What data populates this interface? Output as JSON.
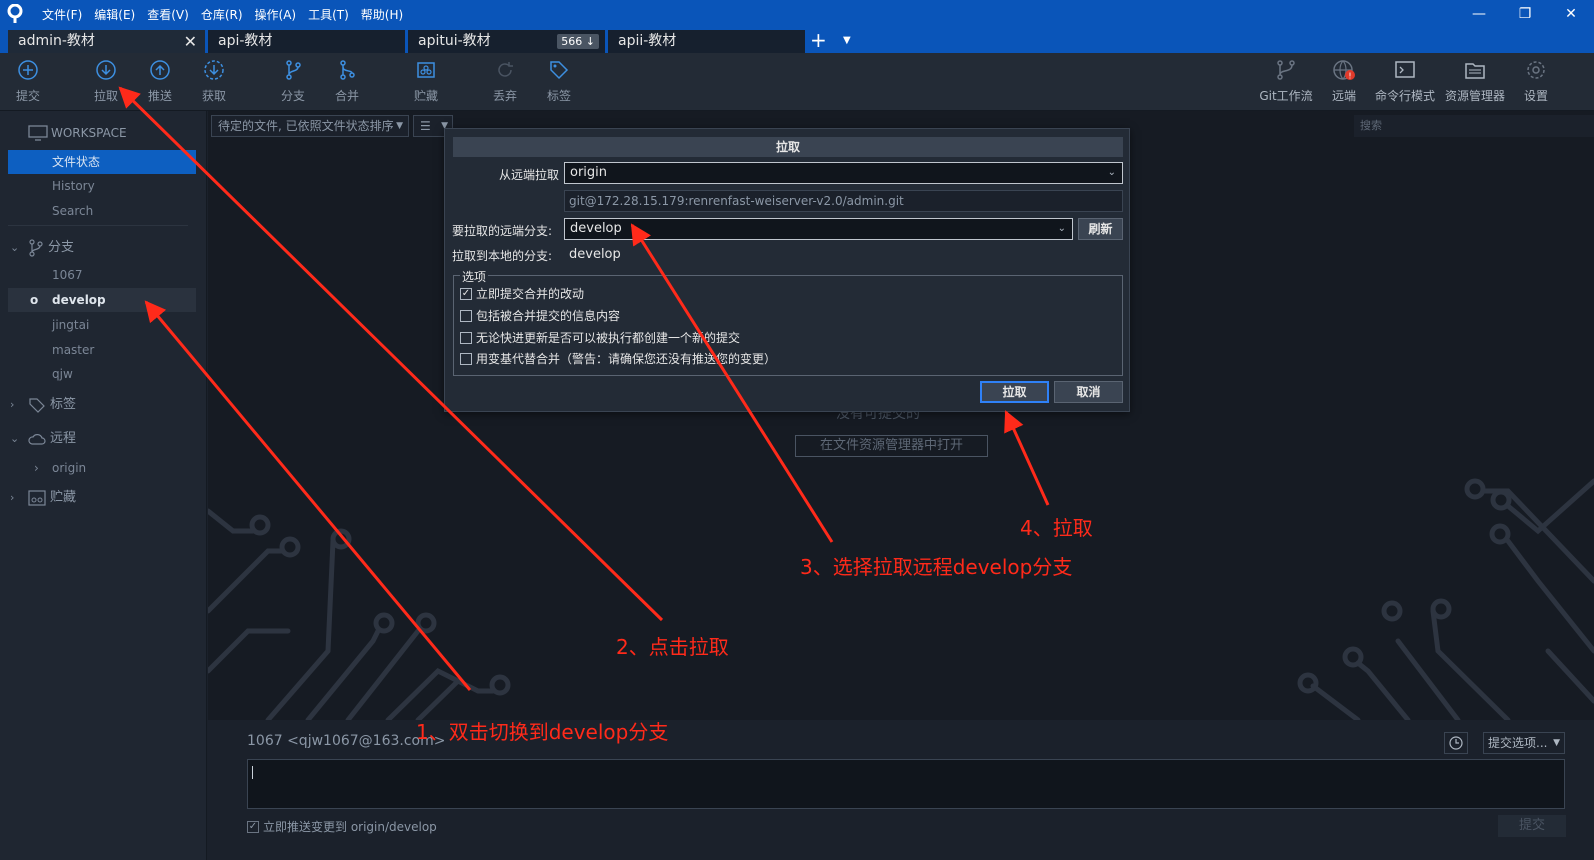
{
  "titlebar": {
    "menus": [
      "文件(F)",
      "编辑(E)",
      "查看(V)",
      "仓库(R)",
      "操作(A)",
      "工具(T)",
      "帮助(H)"
    ],
    "window_controls": [
      "minimize-icon",
      "restore-icon",
      "close-icon"
    ]
  },
  "tabs": [
    {
      "label": "admin-教材",
      "active": true
    },
    {
      "label": "api-教材"
    },
    {
      "label": "apitui-教材",
      "badge": "566 ↓"
    },
    {
      "label": "apii-教材"
    }
  ],
  "toolbar": {
    "left": [
      {
        "label": "提交",
        "icon": "plus-circle-icon"
      },
      {
        "label": "拉取",
        "icon": "arrow-down-circle-icon"
      },
      {
        "label": "推送",
        "icon": "arrow-up-circle-icon"
      },
      {
        "label": "获取",
        "icon": "fetch-circle-icon"
      },
      {
        "label": "分支",
        "icon": "branch-icon"
      },
      {
        "label": "合并",
        "icon": "merge-icon"
      },
      {
        "label": "贮藏",
        "icon": "stash-icon"
      },
      {
        "label": "丢弃",
        "icon": "discard-icon"
      },
      {
        "label": "标签",
        "icon": "tag-icon"
      }
    ],
    "right": [
      {
        "label": "Git工作流",
        "icon": "git-flow-icon"
      },
      {
        "label": "远端",
        "icon": "globe-icon"
      },
      {
        "label": "命令行模式",
        "icon": "terminal-icon"
      },
      {
        "label": "资源管理器",
        "icon": "folder-icon"
      },
      {
        "label": "设置",
        "icon": "gear-icon"
      }
    ]
  },
  "sidebar": {
    "workspace_label": "WORKSPACE",
    "workspace_items": [
      "文件状态",
      "History",
      "Search"
    ],
    "branches_label": "分支",
    "branches": [
      "1067",
      "develop",
      "jingtai",
      "master",
      "qjw"
    ],
    "current_branch_marker": "o",
    "tags_label": "标签",
    "remotes_label": "远程",
    "remotes": [
      "origin"
    ],
    "stashes_label": "贮藏"
  },
  "main": {
    "filter_dropdown": "待定的文件, 已依照文件状态排序",
    "view_dropdown": "☰",
    "search_placeholder": "搜索",
    "empty_text": "没有可提交的",
    "open_in_explorer": "在文件资源管理器中打开"
  },
  "dialog": {
    "title": "拉取",
    "remote_label": "从远端拉取",
    "remote_value": "origin",
    "remote_url": "git@172.28.15.179:renrenfast-weiserver-v2.0/admin.git",
    "remote_branch_label": "要拉取的远端分支:",
    "remote_branch_value": "develop",
    "refresh_button": "刷新",
    "local_branch_label": "拉取到本地的分支:",
    "local_branch_value": "develop",
    "options_legend": "选项",
    "options": [
      {
        "label": "立即提交合并的改动",
        "checked": true
      },
      {
        "label": "包括被合并提交的信息内容",
        "checked": false
      },
      {
        "label": "无论快进更新是否可以被执行都创建一个新的提交",
        "checked": false
      },
      {
        "label": "用变基代替合并（警告：请确保您还没有推送您的变更）",
        "checked": false
      }
    ],
    "ok_button": "拉取",
    "cancel_button": "取消"
  },
  "commit": {
    "author": "1067 <qjw1067@163.com>",
    "options_dropdown": "提交选项...",
    "push_checkbox_label": "立即推送变更到 origin/develop",
    "push_checked": true,
    "commit_button": "提交"
  },
  "annotations": [
    "1、双击切换到develop分支",
    "2、点击拉取",
    "3、选择拉取远程develop分支",
    "4、拉取"
  ],
  "colors": {
    "titlebar": "#0a55b9",
    "selected": "#0d5fc1",
    "annotation": "#ff2a1a"
  }
}
